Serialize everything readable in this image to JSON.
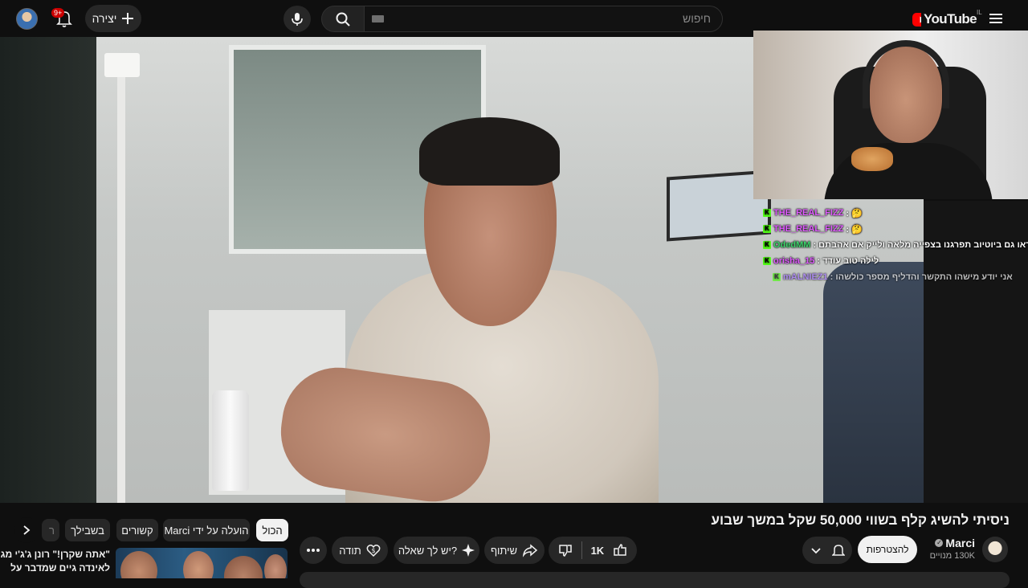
{
  "header": {
    "logo_text": "YouTube",
    "country_code": "IL",
    "search_placeholder": "חיפוש",
    "create_label": "יצירה",
    "notifications_count": "9+"
  },
  "stream_chat": [
    {
      "user": "THE_REAL_FIZZ",
      "message": ": 🤔",
      "user_color": "#e05cff"
    },
    {
      "user": "THE_REAL_FIZZ",
      "message": ": 🤔",
      "user_color": "#e05cff"
    },
    {
      "user": "OdedMM",
      "message": "לכו תראו גם ביוטיוב תפרגנו בצפייה מלאה ולייק אם אהבתם :",
      "user_color": "#3cd26a"
    },
    {
      "user": "orisha_15",
      "message": "לילה טוב עודד :",
      "user_color": "#e05cff"
    },
    {
      "user": "mALNIEZ1",
      "message": "אני יודע מישהו התקשר והדליף מספר כולשהו :",
      "user_color": "#a070ff"
    }
  ],
  "video": {
    "title": "ניסיתי להשיג קלף בשווי 50,000 שקל במשך שבוע"
  },
  "channel": {
    "name": "Marci",
    "subscribers": "130K מנויים",
    "join_label": "להצטרפות"
  },
  "actions": {
    "like_count": "1K",
    "share_label": "שיתוף",
    "ask_label": "יש לך שאלה?",
    "thanks_label": "תודה"
  },
  "filter_chips": [
    "הכול",
    "הועלה על ידי Marci",
    "קשורים",
    "בשבילך",
    "ר"
  ],
  "recommended": {
    "title_line1": "\"אתה שקרן!\" רונן ג'ג'י מגיב",
    "title_line2": "לאינדה גיים שמדבר על"
  },
  "colors": {
    "background": "#0f0f0f",
    "surface": "#272727",
    "youtube_red": "#ff0000",
    "kick_green": "#53fc18"
  }
}
